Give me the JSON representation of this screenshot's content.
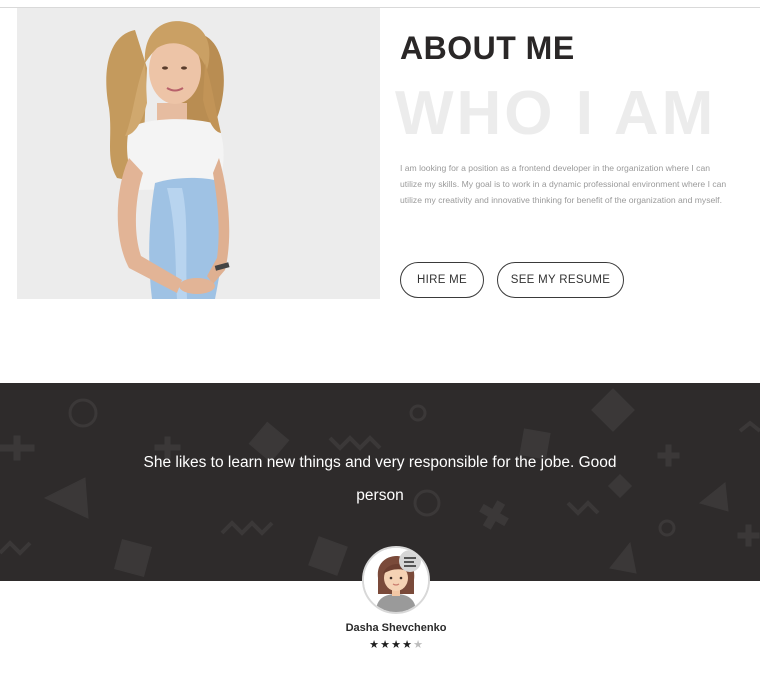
{
  "about": {
    "title": "ABOUT ME",
    "subtitle": "WHO I AM",
    "bio": "I am looking for a position as a frontend developer in the organization where I can utilize my skills. My goal is to work in a dynamic professional environment where I can utilize my creativity and innovative thinking for benefit of the organization and myself.",
    "hire_label": "HIRE ME",
    "resume_label": "SEE MY RESUME"
  },
  "testimonial": {
    "quote": "She likes to learn new things and very responsible for the jobe. Good person",
    "name": "Dasha Shevchenko",
    "rating": 4,
    "rating_max": 5
  },
  "colors": {
    "dark_band": "#2e2b2b",
    "heading": "#2a2727",
    "watermark": "#ececec"
  }
}
